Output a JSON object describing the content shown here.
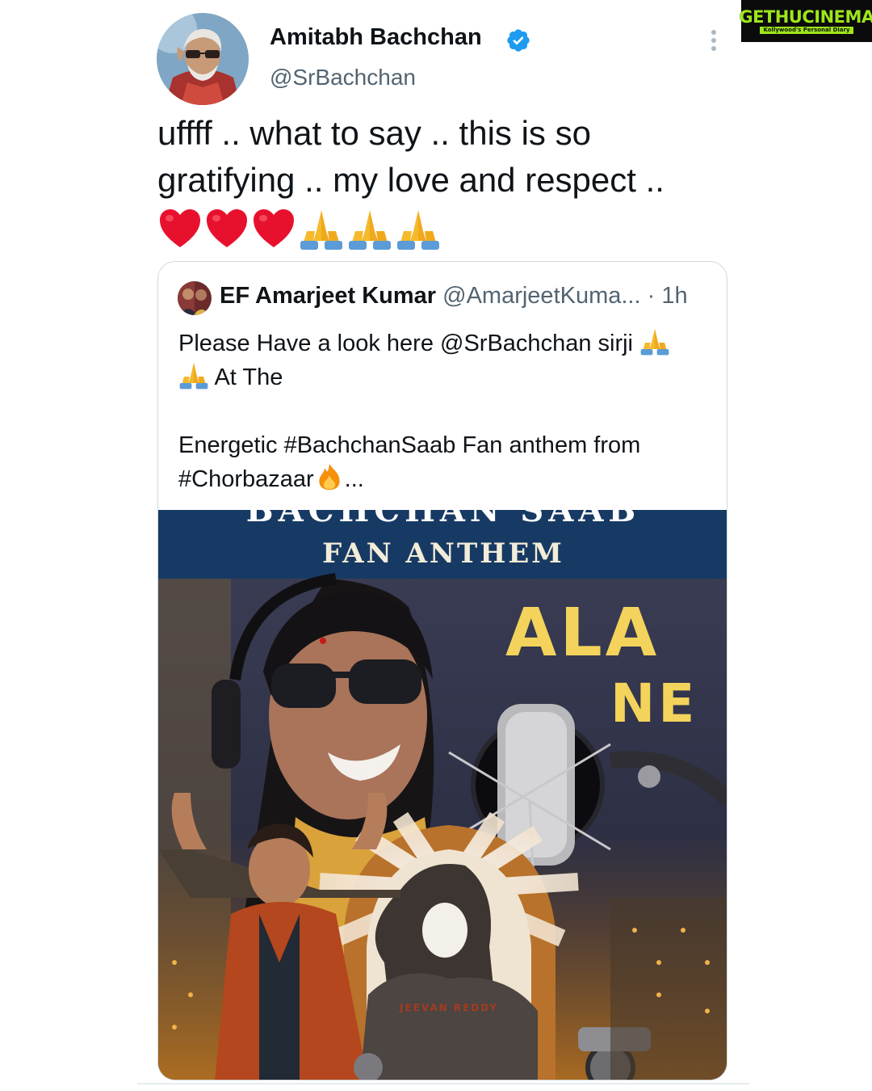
{
  "watermark": {
    "title": "GETHUCINEMA",
    "tagline": "Kollywood's Personal Diary"
  },
  "tweet": {
    "author_name": "Amitabh Bachchan",
    "author_handle": "@SrBachchan",
    "line1": "uffff .. what to say .. this is so",
    "line2": "gratifying .. my love and respect ..",
    "emojis": [
      "red-heart",
      "red-heart",
      "red-heart",
      "folded-hands",
      "folded-hands",
      "folded-hands"
    ]
  },
  "quote": {
    "author_name": "EF Amarjeet Kumar",
    "author_handle": "@AmarjeetKuma...",
    "separator": "·",
    "time": "1h",
    "line1": "Please Have a look here @SrBachchan sirji",
    "line2": "At The",
    "line3": "Energetic #BachchanSaab Fan anthem from",
    "line4": "#Chorbazaar",
    "ellipsis": "...",
    "media": {
      "banner_title_partial": "BACHCHAN SAAB",
      "banner_subtitle": "FAN ANTHEM",
      "song_text_1": "ALA",
      "song_text_2": "NE",
      "poster_credit": "JEEVAN REDDY"
    }
  },
  "colors": {
    "verified": "#1d9bf0",
    "text": "#0f1419",
    "secondary": "#536471",
    "border": "#cfd9de",
    "heart": "#e8112d",
    "hands": "#f5b92c"
  }
}
